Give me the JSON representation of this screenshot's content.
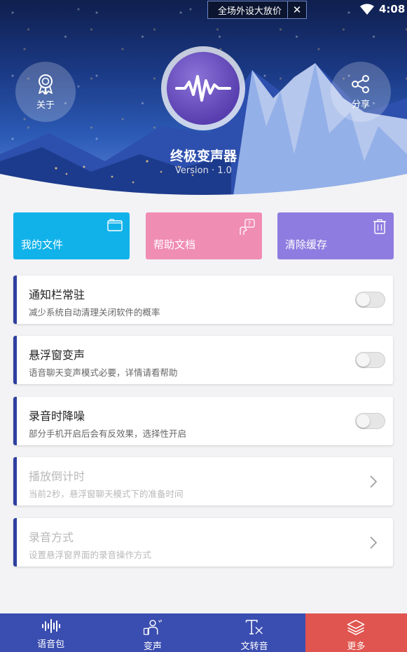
{
  "status_bar": {
    "time": "4:08",
    "wifi_icon": "wifi-icon"
  },
  "ad": {
    "text": "全场外设大放价",
    "close_label": "✕"
  },
  "header": {
    "about_label": "关于",
    "share_label": "分享",
    "app_title": "终极变声器",
    "version": "Version · 1.0"
  },
  "tiles": [
    {
      "label": "我的文件",
      "icon": "folder-icon",
      "color": "#11b2ea"
    },
    {
      "label": "帮助文档",
      "icon": "help-icon",
      "color": "#f08db3"
    },
    {
      "label": "清除缓存",
      "icon": "trash-icon",
      "color": "#8f7ce0"
    }
  ],
  "settings": [
    {
      "title": "通知栏常驻",
      "desc": "减少系统自动清理关闭软件的概率",
      "type": "toggle",
      "enabled": false
    },
    {
      "title": "悬浮窗变声",
      "desc": "语音聊天变声模式必要，详情请看帮助",
      "type": "toggle",
      "enabled": false
    },
    {
      "title": "录音时降噪",
      "desc": "部分手机开启后会有反效果，选择性开启",
      "type": "toggle",
      "enabled": false
    },
    {
      "title": "播放倒计时",
      "desc": "当前2秒，悬浮窗聊天模式下的准备时间",
      "type": "link",
      "disabled": true
    },
    {
      "title": "录音方式",
      "desc": "设置悬浮窗界面的录音操作方式",
      "type": "link",
      "disabled": true
    }
  ],
  "nav": [
    {
      "label": "语音包",
      "icon": "waveform-icon"
    },
    {
      "label": "变声",
      "icon": "voice-change-icon"
    },
    {
      "label": "文转音",
      "icon": "text-to-speech-icon"
    },
    {
      "label": "更多",
      "icon": "layers-icon",
      "active": true
    }
  ],
  "colors": {
    "accent": "#2e3f9e",
    "nav_bg": "#3a4db0",
    "nav_active": "#e0554f"
  }
}
